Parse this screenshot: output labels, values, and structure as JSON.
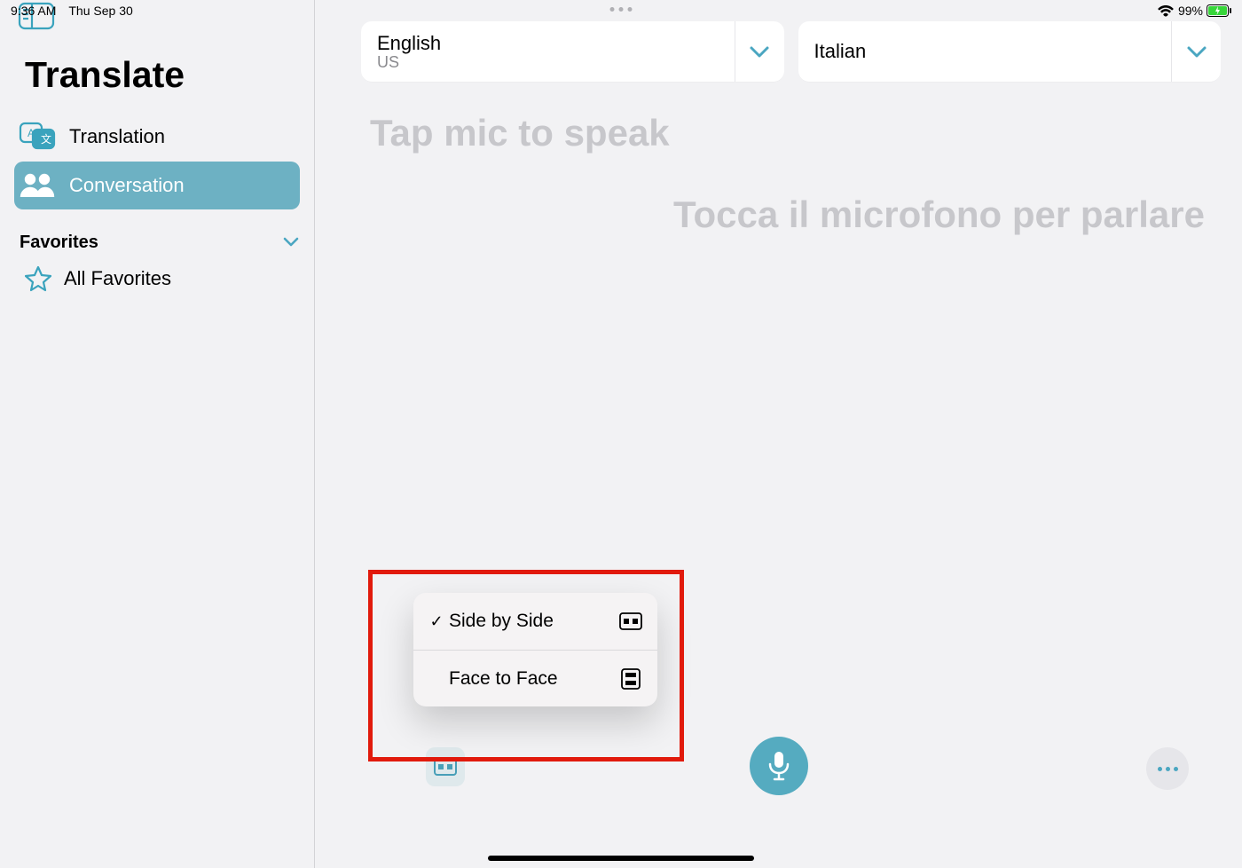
{
  "status": {
    "time": "9:36 AM",
    "date": "Thu Sep 30",
    "battery_pct": "99%"
  },
  "sidebar": {
    "app_title": "Translate",
    "nav": {
      "translation": "Translation",
      "conversation": "Conversation"
    },
    "fav_header": "Favorites",
    "fav_all": "All Favorites"
  },
  "langs": {
    "source": {
      "name": "English",
      "sub": "US"
    },
    "target": {
      "name": "Italian"
    }
  },
  "prompts": {
    "source": "Tap mic to speak",
    "target": "Tocca il microfono per parlare"
  },
  "popup": {
    "side_by_side": "Side by Side",
    "face_to_face": "Face to Face"
  }
}
